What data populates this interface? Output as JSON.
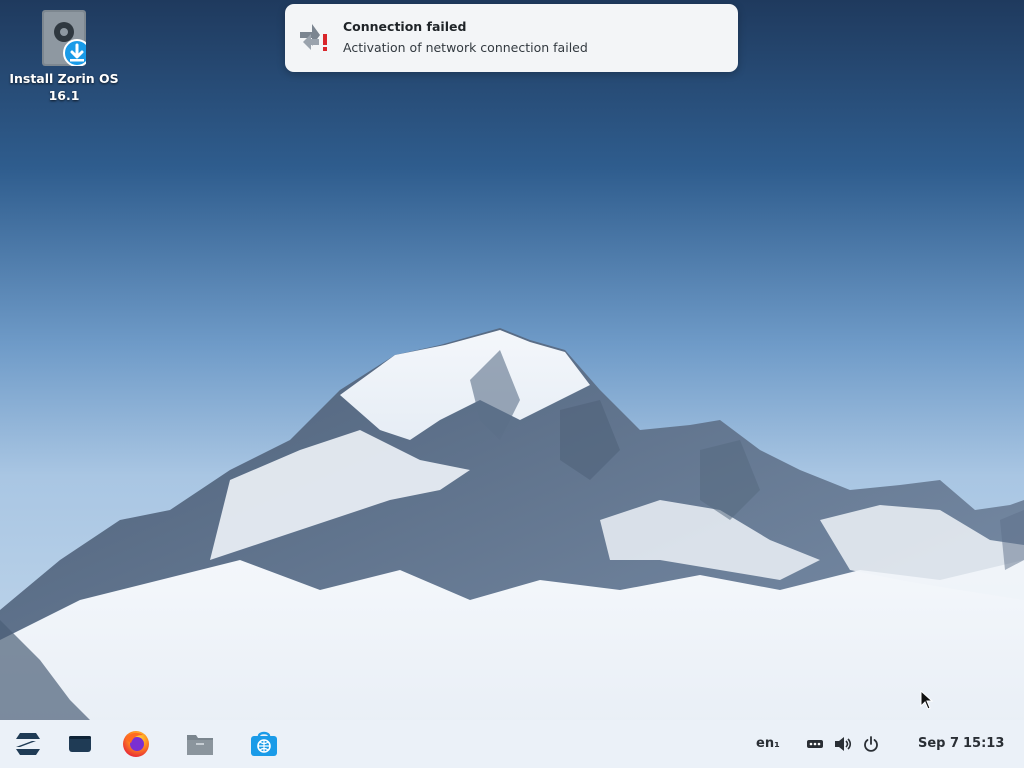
{
  "desktop": {
    "install_icon": {
      "label_line1": "Install Zorin OS",
      "label_line2": "16.1",
      "icon": "install-disk-icon"
    }
  },
  "notification": {
    "title": "Connection failed",
    "body": "Activation of network connection failed",
    "icon": "network-error-icon"
  },
  "taskbar": {
    "launchers": [
      {
        "name": "zorin-menu",
        "icon": "zorin-logo-icon"
      },
      {
        "name": "workspaces",
        "icon": "window-icon"
      },
      {
        "name": "firefox",
        "icon": "firefox-icon"
      },
      {
        "name": "files",
        "icon": "folder-icon"
      },
      {
        "name": "software",
        "icon": "store-icon"
      }
    ],
    "tray": {
      "keyboard_layout": "en₁",
      "network_icon": "network-icon",
      "volume_icon": "volume-icon",
      "power_icon": "power-icon",
      "date": "Sep 7",
      "time": "15:13"
    }
  },
  "colors": {
    "accent": "#1a9be8",
    "taskbar_bg": "#ebf1f7",
    "notification_bg": "#f3f5f7",
    "error_red": "#d9262b"
  }
}
